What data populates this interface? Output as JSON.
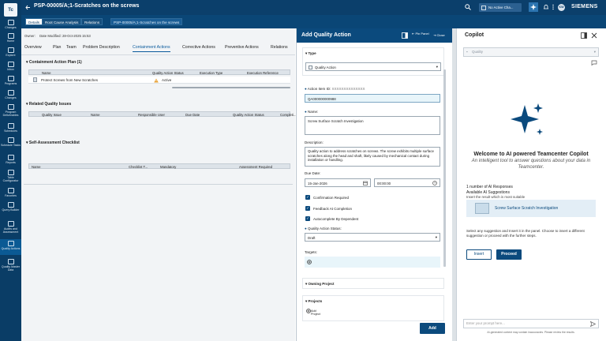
{
  "left_nav": {
    "logo": "Tc",
    "items": [
      "Changes",
      "Home",
      "Explore",
      "Inbox",
      "Programs",
      "Changes",
      "Program Deliverables",
      "Schedules",
      "Schedule Tasks",
      "Reports",
      "Table Configurator",
      "Favorites",
      "Query Builder",
      "Audits and Assessment",
      "Quality Actions",
      "Quality Master Data"
    ]
  },
  "header": {
    "title": "PSP-00005/A;1-Scratches on the screws",
    "user_status": "No Active Cha...",
    "avatar": "KW",
    "brand": "SIEMENS",
    "subtabs": [
      "Details",
      "Root Cause Analysis",
      "Relations"
    ],
    "breadcrumb": "PSP-00005/A;1-Scratches on the screws"
  },
  "main": {
    "owner_label": "Owner:",
    "date_modified": "Date Modified:  28-Oct-2025 15:53",
    "tabs": [
      "Overview",
      "Plan",
      "Team",
      "Problem Description",
      "Containment Actions",
      "Corrective Actions",
      "Preventive Actions",
      "Relations"
    ],
    "active_tab": "Containment Actions",
    "containment": {
      "title": "Containment Action Plan (1)",
      "columns": [
        "Name",
        "Quality Action Status",
        "Execution Type",
        "Execution Reference"
      ],
      "rows": [
        {
          "name": "Protect Screws from New Scratches",
          "status": "Active"
        }
      ]
    },
    "related": {
      "title": "Related Quality Issues",
      "columns": [
        "Quality Issue",
        "Name",
        "Responsible User",
        "Due Date",
        "Quality Action Status",
        "Completi..."
      ]
    },
    "self_assessment": {
      "title": "Self-Assessment Checklist",
      "columns": [
        "Name",
        "Checklist T...",
        "Mandatory",
        "Assessment Required"
      ]
    }
  },
  "dialog": {
    "title": "Add Quality Action",
    "pin_label": "Pin Panel",
    "close_label": "Close",
    "type_section": "Type",
    "type_value": "Quality Action",
    "action_item_id_label": "Action Item ID:",
    "action_item_id_hint": "XXXXXXXXXXXXXX",
    "action_item_id_value": "QA000000000988",
    "name_label": "Name:",
    "name_value": "Screw Surface Scratch Investigation",
    "description_label": "Description:",
    "description_value": "Quality action to address scratches on screws. The screw exhibits multiple surface scratches along the head and shaft, likely caused by mechanical contact during installation or handling.",
    "due_date_label": "Due Date:",
    "due_date_value": "15-Jan-2026",
    "due_time_value": "00:00:00",
    "checkboxes": [
      "Confirmation Required",
      "Feedback At Completion",
      "Autocomplete By Dependent"
    ],
    "status_label": "Quality Action Status:",
    "status_value": "Draft",
    "targets_label": "Targets:",
    "owning_project": "Owning Project",
    "projects": "Projects",
    "add_project": "Add Project",
    "add_button": "Add"
  },
  "copilot": {
    "title": "Copilot",
    "quality_placeholder": "Quality",
    "welcome": "Welcome to AI powered Teamcenter Copilot",
    "subtitle": "An intelligent tool to answer questions about your data in Teamcenter.",
    "responses_count": "1 number of AI Responses",
    "available": "Available AI Suggestions",
    "insert_hint": "Insert the result which is most suitable",
    "suggestion": "Screw Surface Scratch Investigation",
    "instructions": "Select any suggestion and Insert it in the panel. Choose to insert a different suggestion or proceed with the further steps.",
    "insert_button": "Insert",
    "proceed_button": "Proceed",
    "prompt_placeholder": "Enter your prompt here...",
    "disclaimer": "AI-generated content may contain inaccuracies. Please review the results.",
    "accent_color": "#0b4a7d"
  }
}
